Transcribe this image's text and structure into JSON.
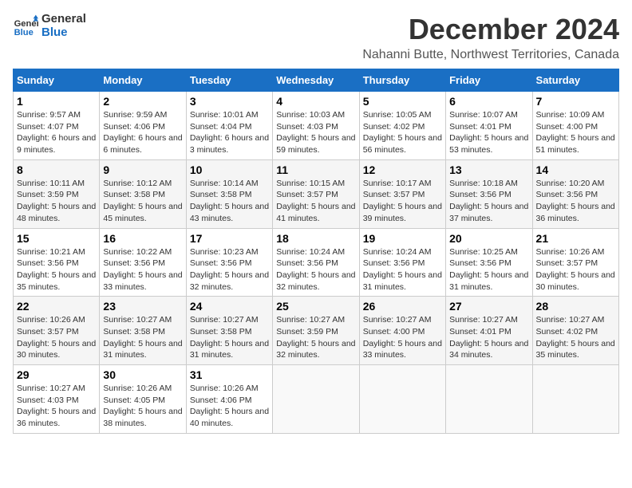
{
  "header": {
    "logo_line1": "General",
    "logo_line2": "Blue",
    "month": "December 2024",
    "location": "Nahanni Butte, Northwest Territories, Canada"
  },
  "weekdays": [
    "Sunday",
    "Monday",
    "Tuesday",
    "Wednesday",
    "Thursday",
    "Friday",
    "Saturday"
  ],
  "weeks": [
    [
      {
        "day": "1",
        "sunrise": "9:57 AM",
        "sunset": "4:07 PM",
        "daylight": "6 hours and 9 minutes."
      },
      {
        "day": "2",
        "sunrise": "9:59 AM",
        "sunset": "4:06 PM",
        "daylight": "6 hours and 6 minutes."
      },
      {
        "day": "3",
        "sunrise": "10:01 AM",
        "sunset": "4:04 PM",
        "daylight": "6 hours and 3 minutes."
      },
      {
        "day": "4",
        "sunrise": "10:03 AM",
        "sunset": "4:03 PM",
        "daylight": "5 hours and 59 minutes."
      },
      {
        "day": "5",
        "sunrise": "10:05 AM",
        "sunset": "4:02 PM",
        "daylight": "5 hours and 56 minutes."
      },
      {
        "day": "6",
        "sunrise": "10:07 AM",
        "sunset": "4:01 PM",
        "daylight": "5 hours and 53 minutes."
      },
      {
        "day": "7",
        "sunrise": "10:09 AM",
        "sunset": "4:00 PM",
        "daylight": "5 hours and 51 minutes."
      }
    ],
    [
      {
        "day": "8",
        "sunrise": "10:11 AM",
        "sunset": "3:59 PM",
        "daylight": "5 hours and 48 minutes."
      },
      {
        "day": "9",
        "sunrise": "10:12 AM",
        "sunset": "3:58 PM",
        "daylight": "5 hours and 45 minutes."
      },
      {
        "day": "10",
        "sunrise": "10:14 AM",
        "sunset": "3:58 PM",
        "daylight": "5 hours and 43 minutes."
      },
      {
        "day": "11",
        "sunrise": "10:15 AM",
        "sunset": "3:57 PM",
        "daylight": "5 hours and 41 minutes."
      },
      {
        "day": "12",
        "sunrise": "10:17 AM",
        "sunset": "3:57 PM",
        "daylight": "5 hours and 39 minutes."
      },
      {
        "day": "13",
        "sunrise": "10:18 AM",
        "sunset": "3:56 PM",
        "daylight": "5 hours and 37 minutes."
      },
      {
        "day": "14",
        "sunrise": "10:20 AM",
        "sunset": "3:56 PM",
        "daylight": "5 hours and 36 minutes."
      }
    ],
    [
      {
        "day": "15",
        "sunrise": "10:21 AM",
        "sunset": "3:56 PM",
        "daylight": "5 hours and 35 minutes."
      },
      {
        "day": "16",
        "sunrise": "10:22 AM",
        "sunset": "3:56 PM",
        "daylight": "5 hours and 33 minutes."
      },
      {
        "day": "17",
        "sunrise": "10:23 AM",
        "sunset": "3:56 PM",
        "daylight": "5 hours and 32 minutes."
      },
      {
        "day": "18",
        "sunrise": "10:24 AM",
        "sunset": "3:56 PM",
        "daylight": "5 hours and 32 minutes."
      },
      {
        "day": "19",
        "sunrise": "10:24 AM",
        "sunset": "3:56 PM",
        "daylight": "5 hours and 31 minutes."
      },
      {
        "day": "20",
        "sunrise": "10:25 AM",
        "sunset": "3:56 PM",
        "daylight": "5 hours and 31 minutes."
      },
      {
        "day": "21",
        "sunrise": "10:26 AM",
        "sunset": "3:57 PM",
        "daylight": "5 hours and 30 minutes."
      }
    ],
    [
      {
        "day": "22",
        "sunrise": "10:26 AM",
        "sunset": "3:57 PM",
        "daylight": "5 hours and 30 minutes."
      },
      {
        "day": "23",
        "sunrise": "10:27 AM",
        "sunset": "3:58 PM",
        "daylight": "5 hours and 31 minutes."
      },
      {
        "day": "24",
        "sunrise": "10:27 AM",
        "sunset": "3:58 PM",
        "daylight": "5 hours and 31 minutes."
      },
      {
        "day": "25",
        "sunrise": "10:27 AM",
        "sunset": "3:59 PM",
        "daylight": "5 hours and 32 minutes."
      },
      {
        "day": "26",
        "sunrise": "10:27 AM",
        "sunset": "4:00 PM",
        "daylight": "5 hours and 33 minutes."
      },
      {
        "day": "27",
        "sunrise": "10:27 AM",
        "sunset": "4:01 PM",
        "daylight": "5 hours and 34 minutes."
      },
      {
        "day": "28",
        "sunrise": "10:27 AM",
        "sunset": "4:02 PM",
        "daylight": "5 hours and 35 minutes."
      }
    ],
    [
      {
        "day": "29",
        "sunrise": "10:27 AM",
        "sunset": "4:03 PM",
        "daylight": "5 hours and 36 minutes."
      },
      {
        "day": "30",
        "sunrise": "10:26 AM",
        "sunset": "4:05 PM",
        "daylight": "5 hours and 38 minutes."
      },
      {
        "day": "31",
        "sunrise": "10:26 AM",
        "sunset": "4:06 PM",
        "daylight": "5 hours and 40 minutes."
      },
      null,
      null,
      null,
      null
    ]
  ],
  "labels": {
    "sunrise": "Sunrise: ",
    "sunset": "Sunset: ",
    "daylight": "Daylight: "
  }
}
